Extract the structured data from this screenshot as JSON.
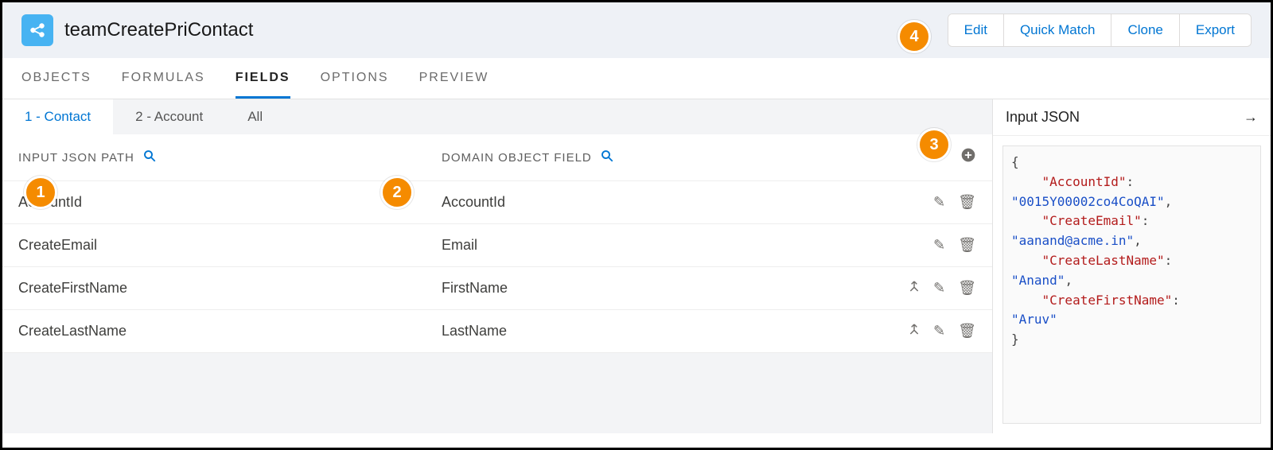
{
  "header": {
    "title": "teamCreatePriContact",
    "buttons": {
      "edit": "Edit",
      "quick_match": "Quick Match",
      "clone": "Clone",
      "export": "Export"
    }
  },
  "tabs": {
    "objects": "OBJECTS",
    "formulas": "FORMULAS",
    "fields": "FIELDS",
    "options": "OPTIONS",
    "preview": "PREVIEW"
  },
  "subtabs": {
    "contact": "1 - Contact",
    "account": "2 - Account",
    "all": "All"
  },
  "columns": {
    "input": "INPUT JSON PATH",
    "domain": "DOMAIN OBJECT FIELD"
  },
  "rows": [
    {
      "input": "AccountId",
      "domain": "AccountId",
      "merge": false
    },
    {
      "input": "CreateEmail",
      "domain": "Email",
      "merge": false
    },
    {
      "input": "CreateFirstName",
      "domain": "FirstName",
      "merge": true
    },
    {
      "input": "CreateLastName",
      "domain": "LastName",
      "merge": true
    }
  ],
  "right_panel": {
    "title": "Input JSON"
  },
  "json_sample": {
    "k0": "\"AccountId\"",
    "v0": "\"0015Y00002co4CoQAI\"",
    "k1": "\"CreateEmail\"",
    "v1": "\"aanand@acme.in\"",
    "k2": "\"CreateLastName\"",
    "v2": "\"Anand\"",
    "k3": "\"CreateFirstName\"",
    "v3": "\"Aruv\""
  },
  "callouts": {
    "c1": "1",
    "c2": "2",
    "c3": "3",
    "c4": "4"
  }
}
